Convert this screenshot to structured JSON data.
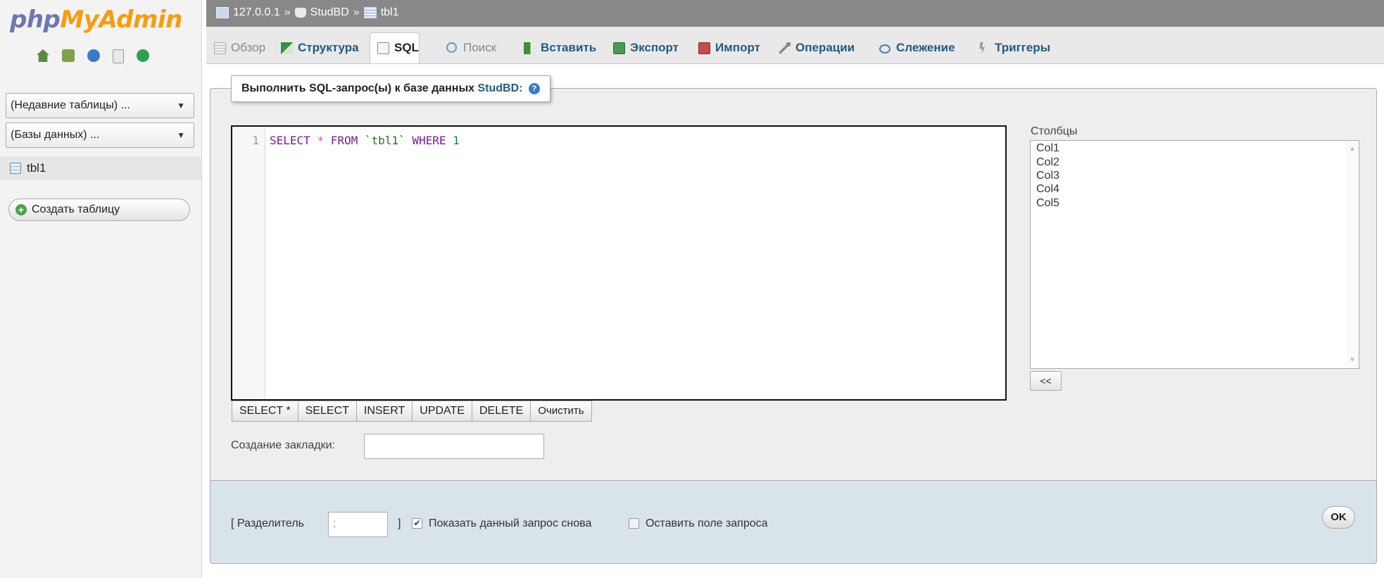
{
  "nav": {
    "logo_part1": "php",
    "logo_part2": "MyAdmin",
    "icons": [
      "home-icon",
      "exit-icon",
      "help-icon",
      "docs-icon",
      "reload-icon"
    ],
    "recent_tables_select": "(Недавние таблицы) ...",
    "databases_select": "(Базы данных) ...",
    "table_item": "tbl1",
    "create_table_button": "Создать таблицу"
  },
  "breadcrumb": {
    "server": "127.0.0.1",
    "database": "StudBD",
    "table": "tbl1",
    "separator": "»"
  },
  "tabs": [
    {
      "label": "Обзор",
      "icon": "browse-icon",
      "state": "disabled"
    },
    {
      "label": "Структура",
      "icon": "structure-icon",
      "state": "normal"
    },
    {
      "label": "SQL",
      "icon": "sql-icon",
      "state": "active"
    },
    {
      "label": "Поиск",
      "icon": "search-icon",
      "state": "disabled"
    },
    {
      "label": "Вставить",
      "icon": "insert-icon",
      "state": "normal"
    },
    {
      "label": "Экспорт",
      "icon": "export-icon",
      "state": "normal"
    },
    {
      "label": "Импорт",
      "icon": "import-icon",
      "state": "normal"
    },
    {
      "label": "Операции",
      "icon": "operations-icon",
      "state": "normal"
    },
    {
      "label": "Слежение",
      "icon": "tracking-icon",
      "state": "normal"
    },
    {
      "label": "Триггеры",
      "icon": "triggers-icon",
      "state": "normal"
    }
  ],
  "query_panel": {
    "legend_text": "Выполнить SQL-запрос(ы) к базе данных",
    "legend_db": "StudBD:",
    "line_number": "1",
    "code": {
      "select": "SELECT",
      "star": "*",
      "from": "FROM",
      "table": "`tbl1`",
      "where": "WHERE",
      "value": "1"
    },
    "buttons": [
      "SELECT *",
      "SELECT",
      "INSERT",
      "UPDATE",
      "DELETE",
      "Очистить"
    ],
    "bookmark_label": "Создание закладки:",
    "bookmark_value": ""
  },
  "columns": {
    "label": "Столбцы",
    "items": [
      "Col1",
      "Col2",
      "Col3",
      "Col4",
      "Col5"
    ],
    "insert_button": "<<"
  },
  "options": {
    "delimiter_open": "[ Разделитель",
    "delimiter_value": ";",
    "delimiter_close": "]",
    "show_query_label": "Показать данный запрос снова",
    "show_query_checked": true,
    "keep_query_label": "Оставить поле запроса",
    "keep_query_checked": false,
    "ok_button": "OK"
  },
  "colors": {
    "brand_blue": "#6c78af",
    "brand_orange": "#f89c0e",
    "breadcrumb_bg": "#888888",
    "link": "#235a81",
    "options_bg": "#d9e3ea"
  }
}
